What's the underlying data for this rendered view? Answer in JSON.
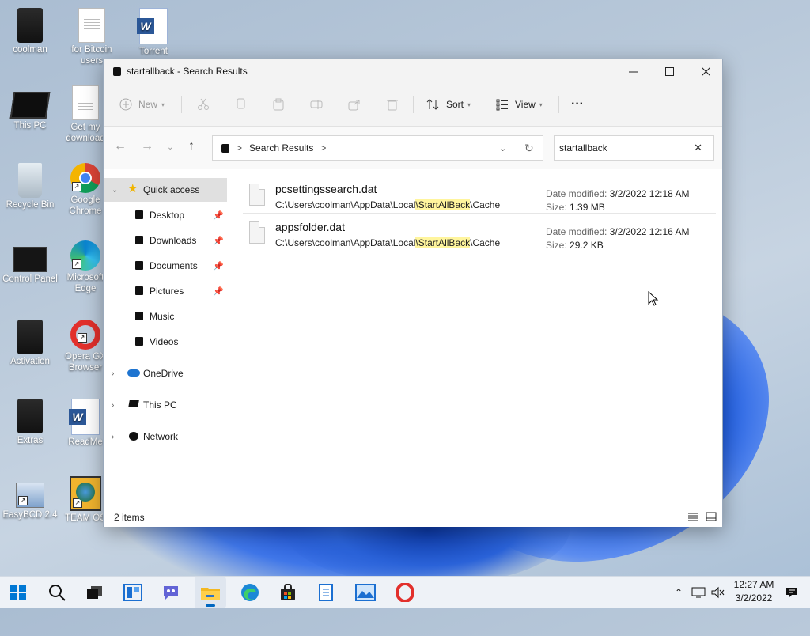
{
  "desktop": {
    "icons": [
      {
        "label": "coolman"
      },
      {
        "label": "for Bitcoin users"
      },
      {
        "label": "Torrent"
      },
      {
        "label": "This PC"
      },
      {
        "label": "Get my download"
      },
      {
        "label": "Recycle Bin"
      },
      {
        "label": "Google Chrome"
      },
      {
        "label": "Control Panel"
      },
      {
        "label": "Microsoft Edge"
      },
      {
        "label": "Activation"
      },
      {
        "label": "Opera GX Browser"
      },
      {
        "label": "Extras"
      },
      {
        "label": "ReadMe"
      },
      {
        "label": "EasyBCD 2.4"
      },
      {
        "label": "TEAM OS"
      }
    ]
  },
  "window": {
    "title": "startallback - Search Results",
    "toolbar": {
      "new_label": "New",
      "sort_label": "Sort",
      "view_label": "View",
      "more_label": "···"
    },
    "address": {
      "path_label": "Search Results",
      "separator": ">"
    },
    "search": {
      "value": "startallback"
    },
    "nav": {
      "quick_access": "Quick access",
      "items": [
        {
          "label": "Desktop",
          "pinned": true
        },
        {
          "label": "Downloads",
          "pinned": true
        },
        {
          "label": "Documents",
          "pinned": true
        },
        {
          "label": "Pictures",
          "pinned": true
        },
        {
          "label": "Music",
          "pinned": false
        },
        {
          "label": "Videos",
          "pinned": false
        }
      ],
      "onedrive": "OneDrive",
      "thispc": "This PC",
      "network": "Network"
    },
    "results": [
      {
        "name": "pcsettingssearch.dat",
        "path_pre": "C:\\Users\\coolman\\AppData\\Local",
        "path_hl": "\\StartAllBack",
        "path_post": "\\Cache",
        "date_label": "Date modified:",
        "date": "3/2/2022 12:18 AM",
        "size_label": "Size:",
        "size": "1.39 MB"
      },
      {
        "name": "appsfolder.dat",
        "path_pre": "C:\\Users\\coolman\\AppData\\Local",
        "path_hl": "\\StartAllBack",
        "path_post": "\\Cache",
        "date_label": "Date modified:",
        "date": "3/2/2022 12:16 AM",
        "size_label": "Size:",
        "size": "29.2 KB"
      }
    ],
    "status": {
      "item_count": "2 items"
    }
  },
  "taskbar": {
    "apps": [
      "start-icon",
      "search-icon",
      "task-view-icon",
      "widgets-icon",
      "chat-icon",
      "file-explorer-icon",
      "edge-icon",
      "store-icon",
      "notepad-icon",
      "photos-icon",
      "opera-icon"
    ],
    "clock": {
      "time": "12:27 AM",
      "date": "3/2/2022"
    }
  },
  "colors": {
    "accent": "#0067c0",
    "highlight": "#fff59d",
    "selected_nav": "#e0e0e0"
  }
}
